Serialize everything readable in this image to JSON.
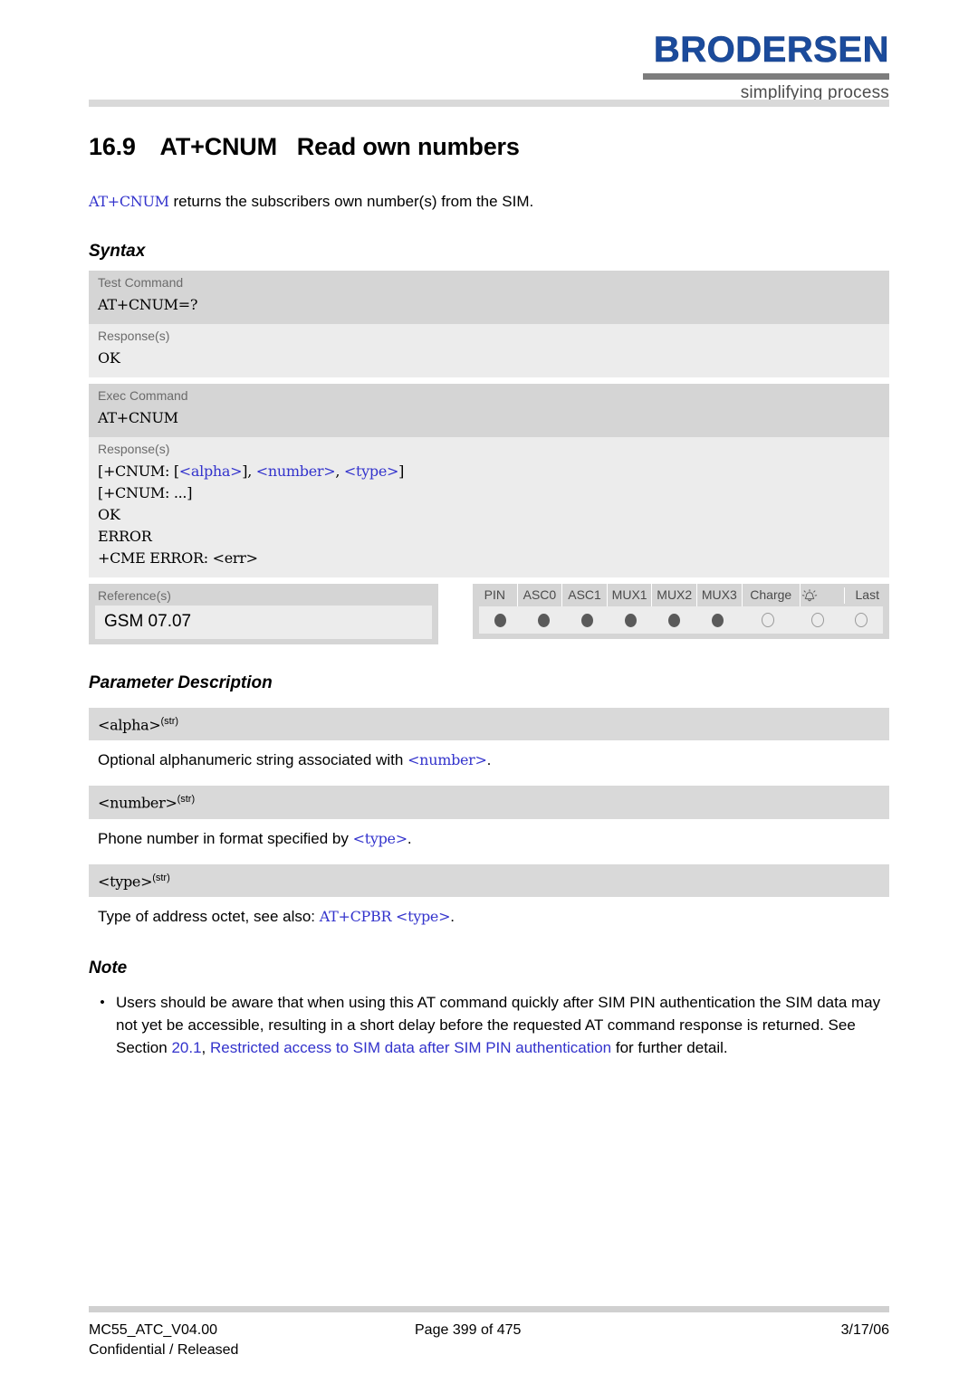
{
  "header": {
    "logo_word": "BRODERSEN",
    "logo_tagline": "simplifying process"
  },
  "document": {
    "section_number": "16.9",
    "command_name": "AT+CNUM",
    "section_title": "Read own numbers",
    "heading_full": "16.9 AT+CNUM   Read own numbers",
    "intro_command": "AT+CNUM",
    "intro_text": " returns the subscribers own number(s) from the SIM."
  },
  "syntax": {
    "heading": "Syntax",
    "blocks": [
      {
        "command_label": "Test Command",
        "command_value": "AT+CNUM=?",
        "response_label": "Response(s)",
        "response_lines": [
          "OK"
        ]
      },
      {
        "command_label": "Exec Command",
        "command_value": "AT+CNUM",
        "response_label": "Response(s)",
        "response_lines": [
          "[+CNUM: [<alpha>], <number>, <type>]",
          "[+CNUM: ...]",
          "OK",
          "ERROR",
          "+CME ERROR: <err>"
        ]
      }
    ],
    "references": {
      "label": "Reference(s)",
      "value": "GSM 07.07"
    },
    "support_matrix": {
      "columns": [
        "PIN",
        "ASC0",
        "ASC1",
        "MUX1",
        "MUX2",
        "MUX3",
        "Charge",
        "alarm-icon",
        "Last"
      ],
      "charge_label": "Charge",
      "alarm_label": "",
      "last_label": "Last",
      "states": [
        "filled",
        "filled",
        "filled",
        "filled",
        "filled",
        "filled",
        "hollow",
        "hollow",
        "hollow"
      ]
    }
  },
  "parameter_description": {
    "heading": "Parameter Description",
    "params": [
      {
        "name": "<alpha>",
        "type_sup": "(str)",
        "desc_prefix": "Optional alphanumeric string associated with ",
        "desc_code": "<number>",
        "desc_suffix": "."
      },
      {
        "name": "<number>",
        "type_sup": "(str)",
        "desc_prefix": "Phone number in format specified by ",
        "desc_code": "<type>",
        "desc_suffix": "."
      },
      {
        "name": "<type>",
        "type_sup": "(str)",
        "desc_prefix": "Type of address octet, see also: ",
        "desc_code": "AT+CPBR <type>",
        "desc_suffix": "."
      }
    ]
  },
  "note": {
    "heading": "Note",
    "bullet": "•",
    "text_part1": "Users should be aware that when using this AT command quickly after SIM PIN authentication the SIM data may not yet be accessible, resulting in a short delay before the requested AT command response is returned. See Section ",
    "link_number": "20.1",
    "text_comma": ", ",
    "link_title": "Restricted access to SIM data after SIM PIN authentication",
    "text_part2": " for further detail."
  },
  "footer": {
    "doc_id": "MC55_ATC_V04.00",
    "classification": "Confidential / Released",
    "page": "Page 399 of 475",
    "date": "3/17/06"
  },
  "colors": {
    "brand_blue": "#1b4b9c",
    "code_blue": "#3333cc",
    "shade_dark": "#d5d5d5",
    "shade_light": "#ececec",
    "rule_gray": "#d9d9d9"
  }
}
